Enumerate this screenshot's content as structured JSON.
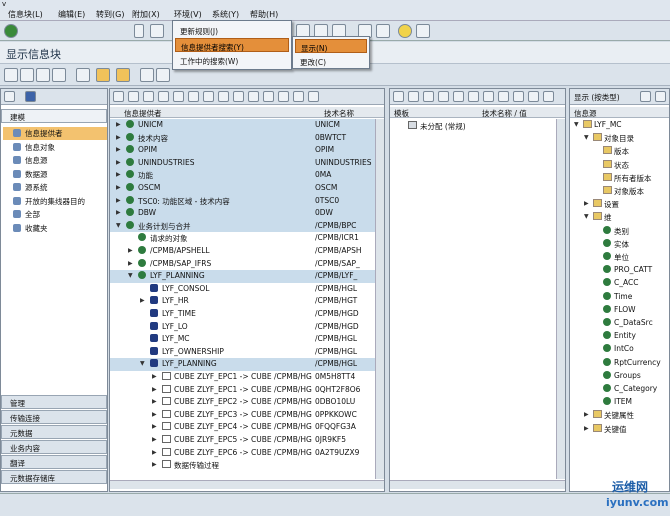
{
  "menubar": {
    "items": [
      "信息块(L)",
      "编辑(E)",
      "转到(G)",
      "附加(X)",
      "环境(V)",
      "系统(Y)",
      "帮助(H)"
    ]
  },
  "title": "显示信息块",
  "nav": {
    "header": "建模",
    "items": [
      "信息提供者",
      "信息对象",
      "信息源",
      "数据源",
      "源系统",
      "开放的集线器目的",
      "全部",
      "收藏夹"
    ],
    "bottom": [
      "管理",
      "传输连接",
      "元数据",
      "业务内容",
      "翻译",
      "元数据存储库"
    ]
  },
  "tree": {
    "col1": "信息提供者",
    "col2": "技术名称",
    "rows": [
      {
        "t": "UNICM",
        "c": "UNICM",
        "lvl": 0,
        "icon": "nd",
        "tri": "▶",
        "sel": true
      },
      {
        "t": "技术内容",
        "c": "0BWTCT",
        "lvl": 0,
        "icon": "nd",
        "tri": "▶",
        "sel": true
      },
      {
        "t": "OPIM",
        "c": "OPIM",
        "lvl": 0,
        "icon": "nd",
        "tri": "▶",
        "sel": true
      },
      {
        "t": "UNINDUSTRIES",
        "c": "UNINDUSTRIES",
        "lvl": 0,
        "icon": "nd",
        "tri": "▶",
        "sel": true
      },
      {
        "t": "功能",
        "c": "0MA",
        "lvl": 0,
        "icon": "nd",
        "tri": "▶",
        "sel": true
      },
      {
        "t": "OSCM",
        "c": "OSCM",
        "lvl": 0,
        "icon": "nd",
        "tri": "▶",
        "sel": true
      },
      {
        "t": "TSC0: 功能区域 - 技术内容",
        "c": "0TSC0",
        "lvl": 0,
        "icon": "nd",
        "tri": "▶",
        "sel": true
      },
      {
        "t": "DBW",
        "c": "0DW",
        "lvl": 0,
        "icon": "nd",
        "tri": "▶",
        "sel": true
      },
      {
        "t": "业务计划与合并",
        "c": "/CPMB/BPC",
        "lvl": 0,
        "icon": "nd",
        "tri": "▼",
        "sel": true
      },
      {
        "t": "请求的对象",
        "c": "/CPMB/ICR1",
        "lvl": 1,
        "icon": "nd",
        "tri": "",
        "sel": false
      },
      {
        "t": "/CPMB/APSHELL",
        "c": "/CPMB/APSH",
        "lvl": 1,
        "icon": "nd",
        "tri": "▶",
        "sel": false
      },
      {
        "t": "/CPMB/SAP_IFRS",
        "c": "/CPMB/SAP_",
        "lvl": 1,
        "icon": "nd",
        "tri": "▶",
        "sel": false
      },
      {
        "t": "LYF_PLANNING",
        "c": "/CPMB/LYF_",
        "lvl": 1,
        "icon": "nd",
        "tri": "▼",
        "sel": true
      },
      {
        "t": "LYF_CONSOL",
        "c": "/CPMB/HGL",
        "lvl": 2,
        "icon": "cube",
        "tri": "",
        "sel": false
      },
      {
        "t": "LYF_HR",
        "c": "/CPMB/HGT",
        "lvl": 2,
        "icon": "cube",
        "tri": "▶",
        "sel": false
      },
      {
        "t": "LYF_TIME",
        "c": "/CPMB/HGD",
        "lvl": 2,
        "icon": "cube",
        "tri": "",
        "sel": false
      },
      {
        "t": "LYF_LO",
        "c": "/CPMB/HGD",
        "lvl": 2,
        "icon": "cube",
        "tri": "",
        "sel": false
      },
      {
        "t": "LYF_MC",
        "c": "/CPMB/HGL",
        "lvl": 2,
        "icon": "cube",
        "tri": "",
        "sel": false
      },
      {
        "t": "LYF_OWNERSHIP",
        "c": "/CPMB/HGL",
        "lvl": 2,
        "icon": "cube",
        "tri": "",
        "sel": false
      },
      {
        "t": "LYF_PLANNING",
        "c": "/CPMB/HGL",
        "lvl": 2,
        "icon": "cube",
        "tri": "▼",
        "sel": true
      },
      {
        "t": "CUBE ZLYF_EPC1 -> CUBE /CPMB/HG",
        "c": "0M5H8TT4",
        "lvl": 3,
        "icon": "leaf",
        "tri": "▶",
        "sel": false
      },
      {
        "t": "CUBE ZLYF_EPC1 -> CUBE /CPMB/HG",
        "c": "0QHT2F8O6",
        "lvl": 3,
        "icon": "leaf",
        "tri": "▶",
        "sel": false
      },
      {
        "t": "CUBE ZLYF_EPC2 -> CUBE /CPMB/HG",
        "c": "0DBO10LU",
        "lvl": 3,
        "icon": "leaf",
        "tri": "▶",
        "sel": false
      },
      {
        "t": "CUBE ZLYF_EPC3 -> CUBE /CPMB/HG",
        "c": "0PPKKOWC",
        "lvl": 3,
        "icon": "leaf",
        "tri": "▶",
        "sel": false
      },
      {
        "t": "CUBE ZLYF_EPC4 -> CUBE /CPMB/HG",
        "c": "0FQQFG3A",
        "lvl": 3,
        "icon": "leaf",
        "tri": "▶",
        "sel": false
      },
      {
        "t": "CUBE ZLYF_EPC5 -> CUBE /CPMB/HG",
        "c": "0JR9KF5",
        "lvl": 3,
        "icon": "leaf",
        "tri": "▶",
        "sel": false
      },
      {
        "t": "CUBE ZLYF_EPC6 -> CUBE /CPMB/HG",
        "c": "0A2T9UZX9",
        "lvl": 3,
        "icon": "leaf",
        "tri": "▶",
        "sel": false
      },
      {
        "t": "数据传输过程",
        "c": "",
        "lvl": 3,
        "icon": "leaf",
        "tri": "▶",
        "sel": false
      }
    ]
  },
  "mid": {
    "col1": "模板",
    "col2": "技术名称 / 值",
    "row": "未分配 (常规)"
  },
  "right": {
    "col1": "信息源",
    "label": "显示 (按类型)",
    "rows": [
      {
        "t": "LYF_MC",
        "lvl": 0,
        "tri": "▼"
      },
      {
        "t": "对象目录",
        "lvl": 1,
        "tri": "▼"
      },
      {
        "t": "版本",
        "lvl": 2,
        "tri": ""
      },
      {
        "t": "状态",
        "lvl": 2,
        "tri": ""
      },
      {
        "t": "所有者版本",
        "lvl": 2,
        "tri": ""
      },
      {
        "t": "对象版本",
        "lvl": 2,
        "tri": ""
      },
      {
        "t": "设置",
        "lvl": 1,
        "tri": "▶"
      },
      {
        "t": "维",
        "lvl": 1,
        "tri": "▼"
      },
      {
        "t": "类别",
        "lvl": 2,
        "tri": ""
      },
      {
        "t": "实体",
        "lvl": 2,
        "tri": ""
      },
      {
        "t": "单位",
        "lvl": 2,
        "tri": ""
      },
      {
        "t": "PRO_CATT",
        "lvl": 2,
        "tri": ""
      },
      {
        "t": "C_ACC",
        "lvl": 2,
        "tri": ""
      },
      {
        "t": "Time",
        "lvl": 2,
        "tri": ""
      },
      {
        "t": "FLOW",
        "lvl": 2,
        "tri": ""
      },
      {
        "t": "C_DataSrc",
        "lvl": 2,
        "tri": ""
      },
      {
        "t": "Entity",
        "lvl": 2,
        "tri": ""
      },
      {
        "t": "IntCo",
        "lvl": 2,
        "tri": ""
      },
      {
        "t": "RptCurrency",
        "lvl": 2,
        "tri": ""
      },
      {
        "t": "Groups",
        "lvl": 2,
        "tri": ""
      },
      {
        "t": "C_Category",
        "lvl": 2,
        "tri": ""
      },
      {
        "t": "ITEM",
        "lvl": 2,
        "tri": ""
      },
      {
        "t": "关键属性",
        "lvl": 1,
        "tri": "▶"
      },
      {
        "t": "关键值",
        "lvl": 1,
        "tri": "▶"
      }
    ]
  },
  "dropdown": {
    "items": [
      "更新规则(J)",
      "信息提供者搜索(Y)",
      "工作中的搜索(W)"
    ]
  },
  "submenu": {
    "items": [
      "显示(N)",
      "更改(C)"
    ]
  },
  "watermark": {
    "line1": "运维网",
    "line2": "iyunv.com"
  }
}
